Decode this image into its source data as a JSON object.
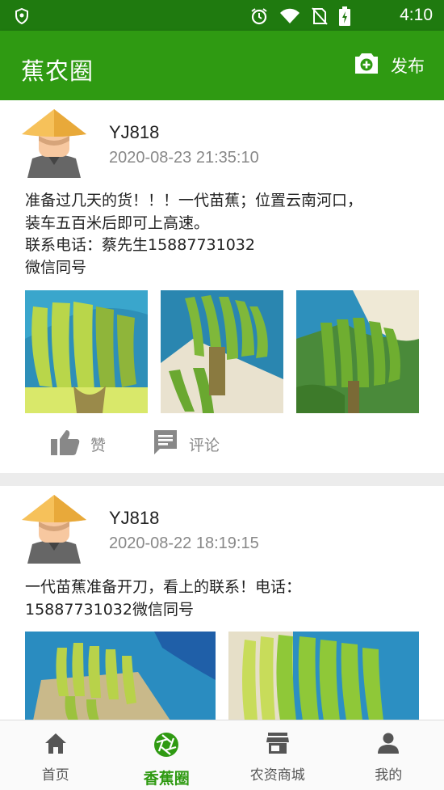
{
  "status": {
    "time": "4:10"
  },
  "appbar": {
    "title": "蕉农圈",
    "publish_label": "发布"
  },
  "posts": [
    {
      "user": "YJ818",
      "time": "2020-08-23 21:35:10",
      "content": "准备过几天的货！！！一代苗蕉；位置云南河口，\n装车五百米后即可上高速。\n联系电话：蔡先生15887731032\n微信同号",
      "like_label": "赞",
      "comment_label": "评论"
    },
    {
      "user": "YJ818",
      "time": "2020-08-22 18:19:15",
      "content": "一代苗蕉准备开刀，看上的联系！电话：\n15887731032微信同号"
    }
  ],
  "tabs": [
    {
      "label": "首页",
      "icon": "home-icon"
    },
    {
      "label": "香蕉圈",
      "icon": "aperture-icon",
      "active": true
    },
    {
      "label": "农资商城",
      "icon": "store-icon"
    },
    {
      "label": "我的",
      "icon": "person-icon"
    }
  ],
  "colors": {
    "statusbar": "#1f7a0f",
    "appbar": "#2f9a12",
    "accent": "#2f9a12"
  }
}
